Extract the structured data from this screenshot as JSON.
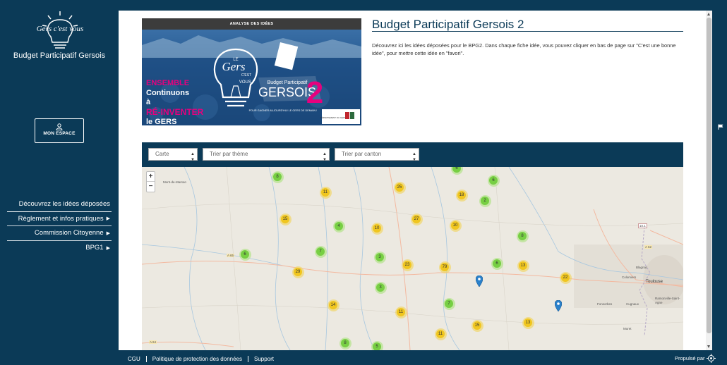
{
  "sidebar": {
    "site_title": "Budget Participatif Gersois",
    "logo_text": "Gers c'est vous",
    "my_space_label": "MON ESPACE",
    "nav": [
      {
        "label": "Découvrez les idées déposées",
        "caret": ""
      },
      {
        "label": "Règlement et infos pratiques",
        "caret": "▶"
      },
      {
        "label": "Commission Citoyenne",
        "caret": "▶"
      },
      {
        "label": "BPG1",
        "caret": "▶"
      }
    ]
  },
  "hero": {
    "top_label": "ANALYSE DES IDÉES",
    "line1": "ENSEMBLE",
    "line2": "Continuons",
    "line3": "à",
    "line4": "RÉ-INVENTER",
    "line5": "le GERS",
    "bulb_le": "LE",
    "bulb_gers": "Gers",
    "bulb_cest": "C'EST",
    "bulb_vous": "VOUS !",
    "bp_label": "Budget Participatif",
    "bp_name": "GERSOIS",
    "bp_num": "2",
    "tagline": "POUR GAGNER AUJOURD'HUI LE GERS DE DEMAIN !",
    "dept_label": "DÉPARTEMENT DU GERS"
  },
  "content": {
    "title": "Budget Participatif Gersois 2",
    "intro": "Découvrez ici les idées déposées pour le BPG2. Dans chaque fiche idée, vous pouvez cliquer en bas de page sur \"C'est une bonne idée\", pour mettre cette idée en \"favori\"."
  },
  "filters": {
    "view": "Carte",
    "theme_placeholder": "Trier par thème",
    "canton_placeholder": "Trier par canton"
  },
  "map": {
    "zoom_in": "+",
    "zoom_out": "−",
    "labels": {
      "mont_de_marsan": "Mont-de-Marsan",
      "toulouse": "Toulouse",
      "blagnac": "Blagnac",
      "colomiers": "Colomiers",
      "cugnaux": "Cugnaux",
      "fonsorbes": "Fonsorbes",
      "muret": "Muret",
      "ramonville": "Ramonville-Saint-Agne",
      "a65": "A 65",
      "a62": "A 62",
      "a64": "A 64",
      "n101": "10.1"
    },
    "clusters": [
      {
        "count": "8",
        "color": "green"
      },
      {
        "count": "6",
        "color": "green"
      },
      {
        "count": "6",
        "color": "green"
      },
      {
        "count": "11",
        "color": "yellow"
      },
      {
        "count": "25",
        "color": "yellow"
      },
      {
        "count": "18",
        "color": "yellow"
      },
      {
        "count": "2",
        "color": "green"
      },
      {
        "count": "15",
        "color": "yellow"
      },
      {
        "count": "4",
        "color": "green"
      },
      {
        "count": "10",
        "color": "yellow"
      },
      {
        "count": "27",
        "color": "yellow"
      },
      {
        "count": "10",
        "color": "yellow"
      },
      {
        "count": "8",
        "color": "green"
      },
      {
        "count": "6",
        "color": "green"
      },
      {
        "count": "7",
        "color": "green"
      },
      {
        "count": "3",
        "color": "green"
      },
      {
        "count": "23",
        "color": "yellow"
      },
      {
        "count": "79",
        "color": "yellow"
      },
      {
        "count": "6",
        "color": "green"
      },
      {
        "count": "13",
        "color": "yellow"
      },
      {
        "count": "29",
        "color": "yellow"
      },
      {
        "count": "22",
        "color": "yellow"
      },
      {
        "count": "3",
        "color": "green"
      },
      {
        "count": "14",
        "color": "yellow"
      },
      {
        "count": "11",
        "color": "yellow"
      },
      {
        "count": "7",
        "color": "green"
      },
      {
        "count": "15",
        "color": "yellow"
      },
      {
        "count": "13",
        "color": "yellow"
      },
      {
        "count": "11",
        "color": "yellow"
      },
      {
        "count": "8",
        "color": "green"
      },
      {
        "count": "5",
        "color": "green"
      }
    ]
  },
  "footer": {
    "links": [
      "CGU",
      "Politique de protection des données",
      "Support"
    ],
    "powered_by": "Propulsé par"
  },
  "colors": {
    "navy": "#0b3a57",
    "cluster_yellow": "#f0c20c",
    "cluster_green": "#6ecc39",
    "pink": "#e6007e"
  }
}
